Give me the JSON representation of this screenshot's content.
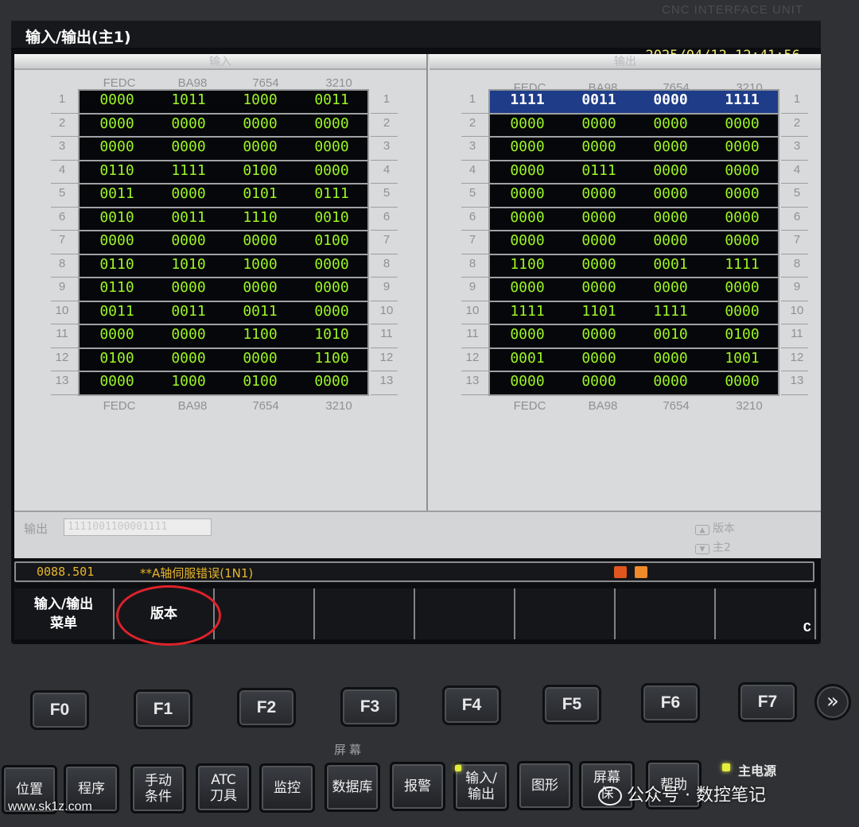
{
  "bezel": {
    "brand": "CNC INTERFACE UNIT"
  },
  "title": "输入/输出(主1)",
  "clock": "2025/04/12 12:41:56",
  "input_pane": {
    "header": "输入",
    "col_headers": [
      "FEDC",
      "BA98",
      "7654",
      "3210"
    ],
    "row_numbers": [
      "1",
      "2",
      "3",
      "4",
      "5",
      "6",
      "7",
      "8",
      "9",
      "10",
      "11",
      "12",
      "13"
    ],
    "rows": [
      [
        "0000",
        "1011",
        "1000",
        "0011"
      ],
      [
        "0000",
        "0000",
        "0000",
        "0000"
      ],
      [
        "0000",
        "0000",
        "0000",
        "0000"
      ],
      [
        "0110",
        "1111",
        "0100",
        "0000"
      ],
      [
        "0011",
        "0000",
        "0101",
        "0111"
      ],
      [
        "0010",
        "0011",
        "1110",
        "0010"
      ],
      [
        "0000",
        "0000",
        "0000",
        "0100"
      ],
      [
        "0110",
        "1010",
        "1000",
        "0000"
      ],
      [
        "0110",
        "0000",
        "0000",
        "0000"
      ],
      [
        "0011",
        "0011",
        "0011",
        "0000"
      ],
      [
        "0000",
        "0000",
        "1100",
        "1010"
      ],
      [
        "0100",
        "0000",
        "0000",
        "1100"
      ],
      [
        "0000",
        "1000",
        "0100",
        "0000"
      ]
    ]
  },
  "output_pane": {
    "header": "输出",
    "col_headers": [
      "FEDC",
      "BA98",
      "7654",
      "3210"
    ],
    "row_numbers": [
      "1",
      "2",
      "3",
      "4",
      "5",
      "6",
      "7",
      "8",
      "9",
      "10",
      "11",
      "12",
      "13"
    ],
    "selected_row": 0,
    "rows": [
      [
        "1111",
        "0011",
        "0000",
        "1111"
      ],
      [
        "0000",
        "0000",
        "0000",
        "0000"
      ],
      [
        "0000",
        "0000",
        "0000",
        "0000"
      ],
      [
        "0000",
        "0111",
        "0000",
        "0000"
      ],
      [
        "0000",
        "0000",
        "0000",
        "0000"
      ],
      [
        "0000",
        "0000",
        "0000",
        "0000"
      ],
      [
        "0000",
        "0000",
        "0000",
        "0000"
      ],
      [
        "1100",
        "0000",
        "0001",
        "1111"
      ],
      [
        "0000",
        "0000",
        "0000",
        "0000"
      ],
      [
        "1111",
        "1101",
        "1111",
        "0000"
      ],
      [
        "0000",
        "0000",
        "0010",
        "0100"
      ],
      [
        "0001",
        "0000",
        "0000",
        "1001"
      ],
      [
        "0000",
        "0000",
        "0000",
        "0000"
      ]
    ]
  },
  "output_field": {
    "label": "输出",
    "value": "1111001100001111"
  },
  "page_hints": {
    "up_key": "▲",
    "up_label": "版本",
    "down_key": "▼",
    "down_label": "主2"
  },
  "alarm": {
    "code": "0088.501",
    "message": "**A轴伺服错误(1N1)",
    "colors": [
      "#e0561f",
      "#f08a2a"
    ]
  },
  "softkeys": [
    "输入/输出\n菜单",
    "版本",
    "",
    "",
    "",
    "",
    "",
    ""
  ],
  "softkey_corner": "C",
  "fkeys": [
    "F0",
    "F1",
    "F2",
    "F3",
    "F4",
    "F5",
    "F6",
    "F7"
  ],
  "fkey_more": "»",
  "screen_group_label": "屏幕",
  "hard_keys": [
    "位置",
    "程序",
    "手动\n条件",
    "ATC\n刀具",
    "监控",
    "数据库",
    "报警",
    "输入/\n输出",
    "图形",
    "屏幕\n保",
    "帮助"
  ],
  "main_power": "主电源",
  "watermark": {
    "site": "www.sk1z.com",
    "account": "公众号 · 数控笔记"
  }
}
